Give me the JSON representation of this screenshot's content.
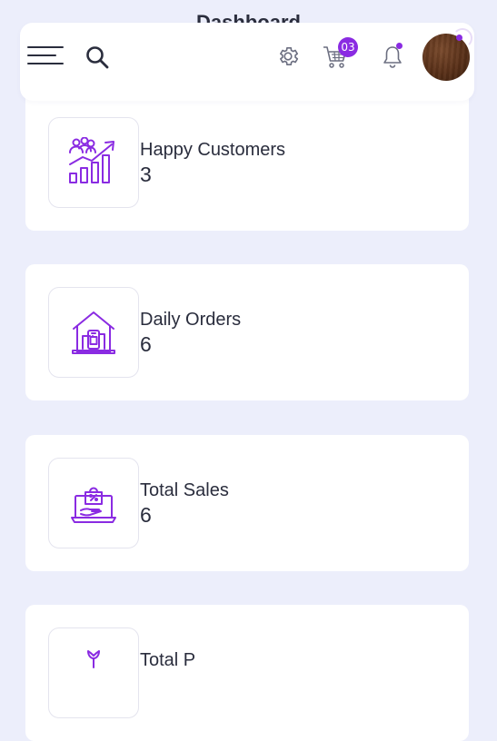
{
  "page": {
    "title": "Dashboard"
  },
  "header": {
    "cart_count": "03",
    "avatar_alt": "User avatar"
  },
  "stats": [
    {
      "label": "Happy Customers",
      "value": "3",
      "icon": "growth-chart-customers-icon"
    },
    {
      "label": "Daily Orders",
      "value": "6",
      "icon": "house-phone-icon"
    },
    {
      "label": "Total Sales",
      "value": "6",
      "icon": "laptop-shopping-bag-icon"
    },
    {
      "label": "Total Products",
      "value": "",
      "icon": "flower-product-icon"
    }
  ],
  "colors": {
    "accent": "#8a2be2",
    "background": "#eceefb",
    "card": "#ffffff",
    "text": "#2a2d3d"
  }
}
